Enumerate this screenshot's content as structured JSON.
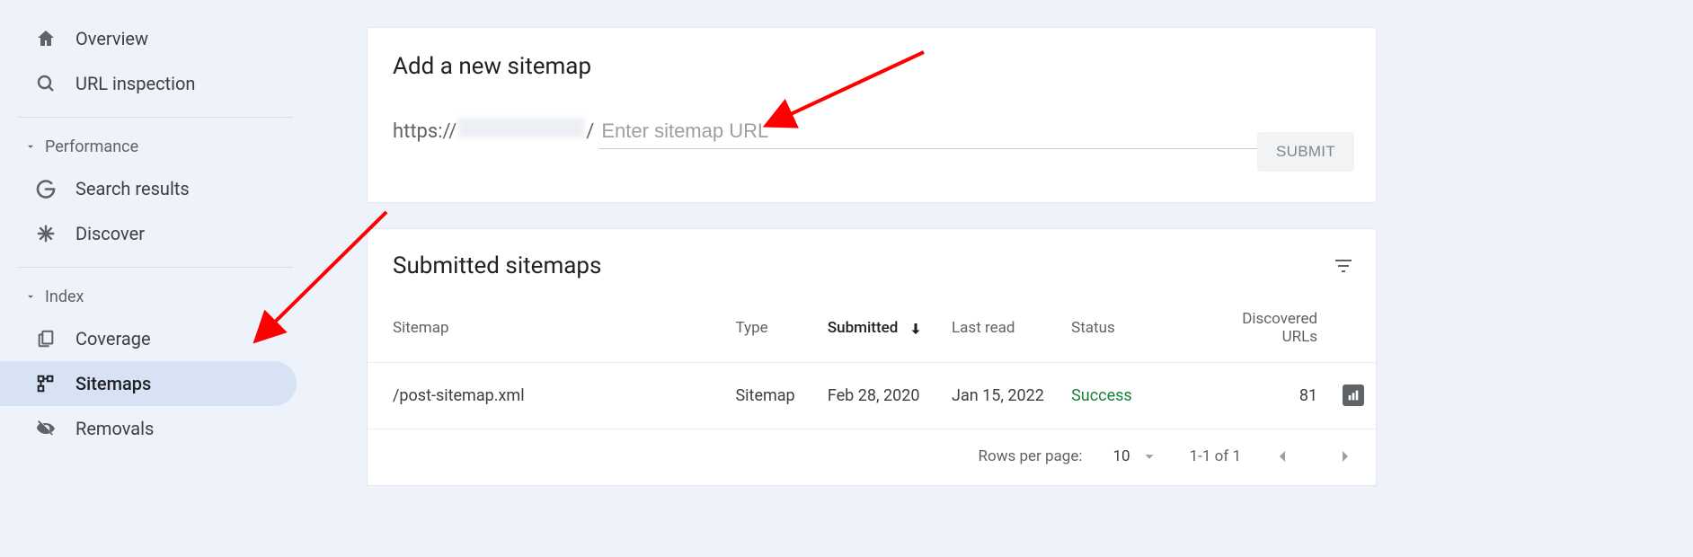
{
  "sidebar": {
    "items": [
      {
        "label": "Overview"
      },
      {
        "label": "URL inspection"
      }
    ],
    "sections": [
      {
        "title": "Performance",
        "items": [
          {
            "label": "Search results"
          },
          {
            "label": "Discover"
          }
        ]
      },
      {
        "title": "Index",
        "items": [
          {
            "label": "Coverage"
          },
          {
            "label": "Sitemaps",
            "selected": true
          },
          {
            "label": "Removals"
          }
        ]
      }
    ]
  },
  "add_card": {
    "title": "Add a new sitemap",
    "url_prefix_visible": "https://",
    "url_prefix_trail": "/",
    "input_placeholder": "Enter sitemap URL",
    "input_value": "",
    "submit_label": "SUBMIT"
  },
  "list_card": {
    "title": "Submitted sitemaps",
    "columns": {
      "sitemap": "Sitemap",
      "type": "Type",
      "submitted": "Submitted",
      "last_read": "Last read",
      "status": "Status",
      "discovered": "Discovered URLs"
    },
    "sorted_column": "submitted",
    "rows": [
      {
        "sitemap": "/post-sitemap.xml",
        "type": "Sitemap",
        "submitted": "Feb 28, 2020",
        "last_read": "Jan 15, 2022",
        "status": "Success",
        "discovered": "81"
      }
    ],
    "footer": {
      "rows_per_page_label": "Rows per page:",
      "rows_per_page_value": "10",
      "range_text": "1-1 of 1"
    }
  },
  "colors": {
    "page_bg": "#eef2fa",
    "card_bg": "#ffffff",
    "selected_bg": "#d7e3f4",
    "success": "#188038",
    "arrow": "#ff0000"
  }
}
